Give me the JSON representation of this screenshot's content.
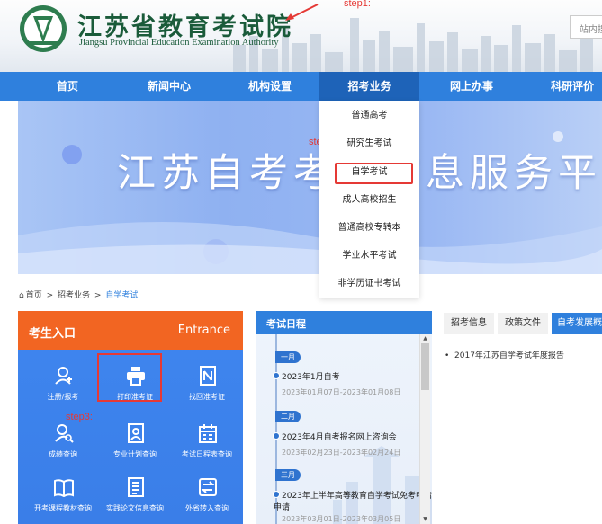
{
  "header": {
    "logo_cn": "江苏省教育考试院",
    "logo_en": "Jiangsu Provincial Education Examination Authority",
    "step1": "step1:",
    "search_placeholder": "站内搜"
  },
  "nav": {
    "items": [
      "首页",
      "新闻中心",
      "机构设置",
      "招考业务",
      "网上办事",
      "科研评价"
    ],
    "active_index": 3
  },
  "banner": {
    "title": "江苏自考考试信息服务平台"
  },
  "dropdown": {
    "step2": "step2:",
    "items": [
      "普通高考",
      "研究生考试",
      "自学考试",
      "成人高校招生",
      "普通高校专转本",
      "学业水平考试",
      "非学历证书考试"
    ],
    "highlight_index": 2
  },
  "breadcrumb": {
    "home": "首页",
    "sep": ">",
    "level1": "招考业务",
    "current": "自学考试"
  },
  "candidate": {
    "title": "考生入口",
    "title_en": "Entrance",
    "step3": "step3:",
    "tiles": [
      {
        "label": "注册/报考",
        "icon": "user-add-icon"
      },
      {
        "label": "打印准考证",
        "icon": "printer-icon"
      },
      {
        "label": "找回准考证",
        "icon": "id-card-icon"
      },
      {
        "label": "成绩查询",
        "icon": "user-search-icon"
      },
      {
        "label": "专业计划查询",
        "icon": "plan-icon"
      },
      {
        "label": "考试日程表查询",
        "icon": "calendar-icon"
      },
      {
        "label": "开考课程教材查询",
        "icon": "book-icon"
      },
      {
        "label": "实践论文信息查询",
        "icon": "document-icon"
      },
      {
        "label": "外省转入查询",
        "icon": "transfer-icon"
      }
    ]
  },
  "schedule": {
    "title": "考试日程",
    "months": [
      "一月",
      "二月",
      "三月"
    ],
    "events": [
      {
        "title": "2023年1月自考",
        "date": "2023年01月07日-2023年01月08日"
      },
      {
        "title": "2023年4月自考报名网上咨询会",
        "date": "2023年02月23日-2023年02月24日"
      },
      {
        "title": "2023年上半年高等教育自学考试免考申请",
        "title2": "申请",
        "date": "2023年03月01日-2023年03月05日"
      }
    ]
  },
  "tabs": {
    "items": [
      "招考信息",
      "政策文件",
      "自考发展概"
    ],
    "active_index": 2,
    "report": "2017年江苏自学考试年度报告"
  }
}
